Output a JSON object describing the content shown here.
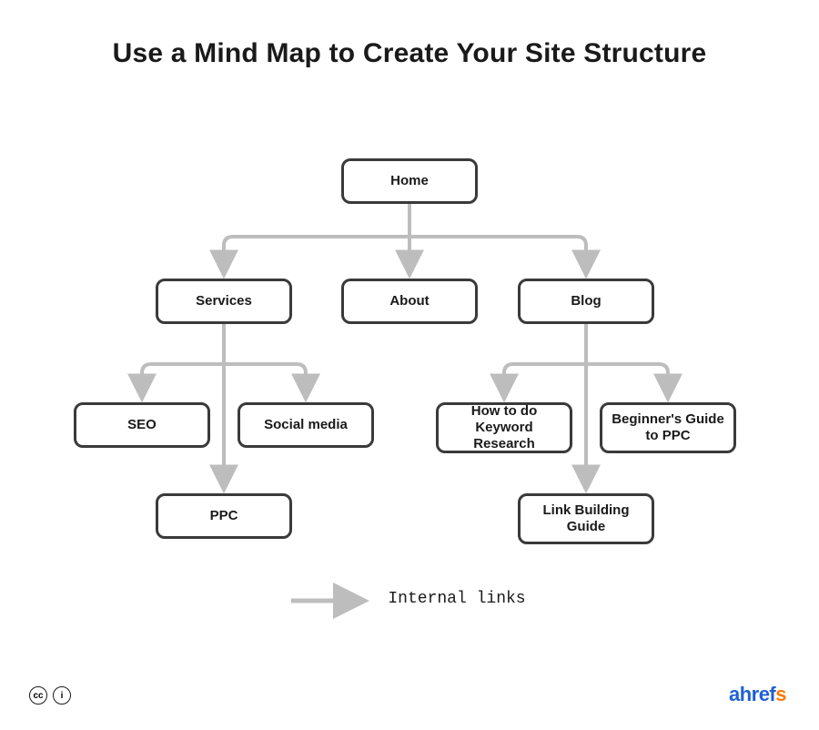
{
  "title": "Use a Mind Map to Create Your Site Structure",
  "nodes": {
    "home": "Home",
    "services": "Services",
    "about": "About",
    "blog": "Blog",
    "seo": "SEO",
    "social": "Social media",
    "ppc": "PPC",
    "howto": "How to do Keyword Research",
    "beginner": "Beginner's Guide to PPC",
    "link": "Link Building Guide"
  },
  "legend": "Internal links",
  "brand": {
    "part1": "ahref",
    "part2": "s"
  },
  "license": {
    "cc": "cc",
    "by": "i"
  },
  "colors": {
    "stroke": "#3a3a3a",
    "arrow": "#bdbdbd"
  }
}
